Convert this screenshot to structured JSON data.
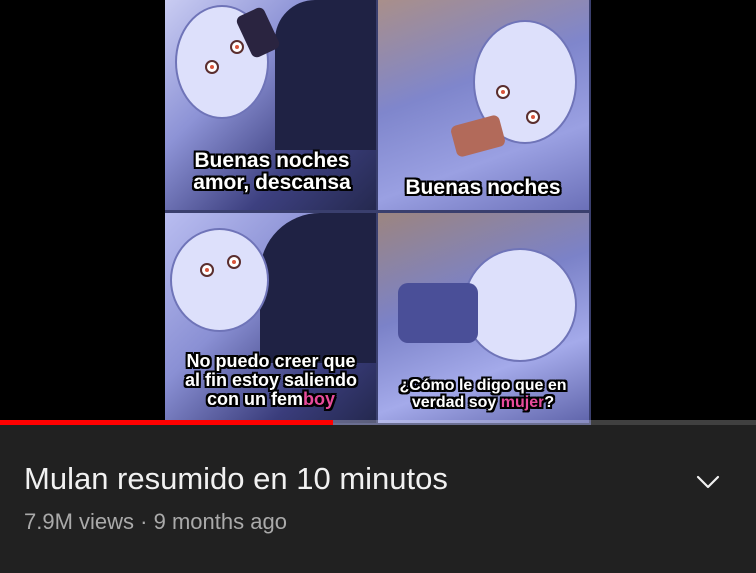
{
  "video": {
    "title": "Mulan resumido en 10 minutos",
    "views": "7.9M views",
    "separator": "·",
    "age": "9 months ago",
    "progress_fraction": 0.44,
    "expand_icon": "chevron-down-icon"
  },
  "meme": {
    "panel1_line1": "Buenas noches",
    "panel1_line2": "amor, descansa",
    "panel2": "Buenas noches",
    "panel3_line1": "No puedo creer que",
    "panel3_line2": "al fin estoy saliendo",
    "panel3_line3a": "con un fem",
    "panel3_line3b": "boy",
    "panel4_line1": "¿Cómo le digo que en",
    "panel4_line2a": "verdad soy ",
    "panel4_line2b": "mujer",
    "panel4_line2c": "?"
  },
  "colors": {
    "background": "#212121",
    "progress": "#ff0000",
    "title": "#f1f1f1",
    "meta": "#aaaaaa",
    "highlight": "#e84c9c"
  }
}
